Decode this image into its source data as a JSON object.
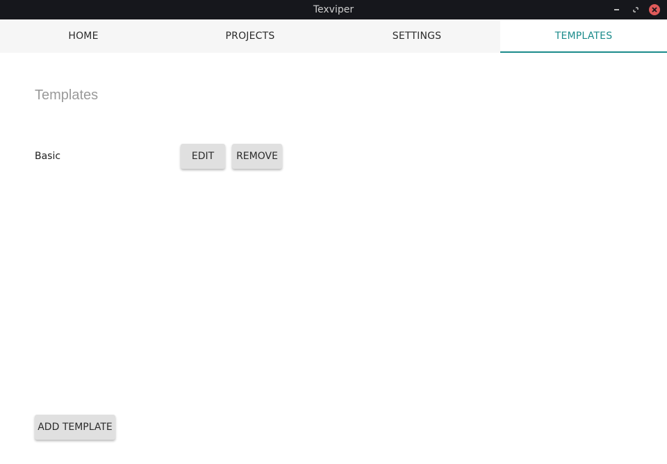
{
  "window": {
    "title": "Texviper"
  },
  "tabs": [
    {
      "label": "HOME",
      "active": false
    },
    {
      "label": "PROJECTS",
      "active": false
    },
    {
      "label": "SETTINGS",
      "active": false
    },
    {
      "label": "TEMPLATES",
      "active": true
    }
  ],
  "main": {
    "heading": "Templates",
    "templates": [
      {
        "name": "Basic",
        "edit_label": "EDIT",
        "remove_label": "REMOVE"
      }
    ],
    "add_label": "ADD TEMPLATE"
  },
  "colors": {
    "accent": "#1a8a8a",
    "titlebar": "#16171c",
    "close_button": "#e05a5a",
    "button_bg": "#e0e0e0"
  }
}
